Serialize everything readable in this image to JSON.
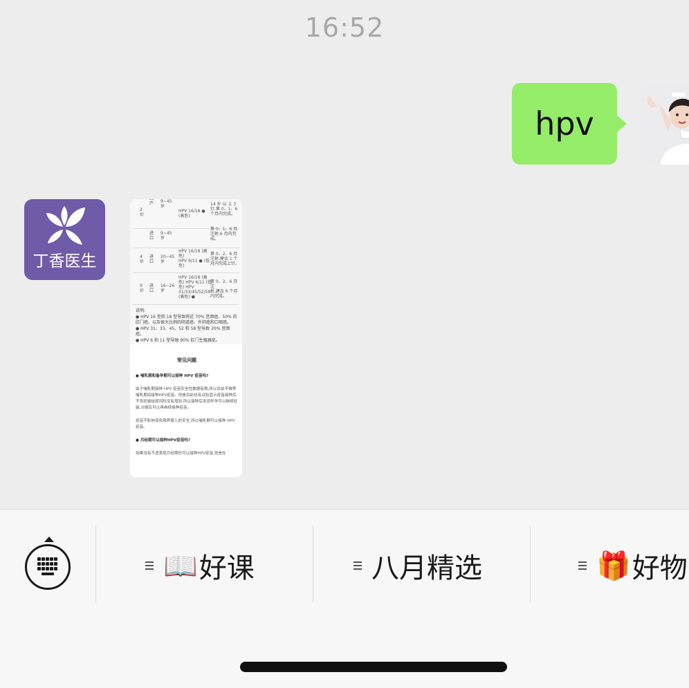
{
  "chat": {
    "timestamp": "16:52",
    "outgoing_message": "hpv",
    "bot_avatar_label": "丁香医生",
    "bot_avatar_color": "#6f5ba8",
    "outgoing_bubble_color": "#95ec69"
  },
  "doc_image": {
    "table_rows": [
      {
        "c1": "2\n价",
        "c2": "国\n产",
        "c3": "9~45\n岁",
        "c4": "HPV 16/18 ●\n(高危)",
        "c5": "14 岁 以 上 3\n针,第 0、1、6\n个月内完成。"
      },
      {
        "c1": "",
        "c2": "进\n口",
        "c3": "9~45\n岁",
        "c4": "",
        "c5": "第 0、1、6 月\n注射,6 月内完\n成。"
      },
      {
        "c1": "4\n价",
        "c2": "进\n口",
        "c3": "20~45\n岁",
        "c4": "HPV 16/18 (高\n危)\nHPV 6/11 ● (低\n危)",
        "c5": "第 0、2、6 月\n注射,建议 1 个\n月内完成上针。"
      },
      {
        "c1": "9\n价",
        "c2": "进\n口",
        "c3": "16~26\n岁",
        "c4": "HPV 16/18 (高\n危) HPV 6/11 (低\n危) HPV\n31/33/45/52/58\n(高危) ●",
        "c5": "第 0、2、6 月注\n射,建议 6 个月\n内完成。"
      }
    ],
    "notes": [
      "说明:",
      "● HPV 16 型和 18 型导致将近 70% 宫颈癌、50% 的肛门癌、以及很大比例的阴道癌、外阴癌和口咽癌。",
      "● HPV 31、33、45、52 和 58 型导致 20% 宫颈癌。",
      "● HPV 6 和 11 型导致 90% 肛门生殖器疣。"
    ],
    "faq_title": "常见问题",
    "faq": [
      {
        "text": "● 哺乳期和备孕期可以接种 HPV 疫苗吗?",
        "q": true
      },
      {
        "text": "由于哺乳期接种 HPV 疫苗安全性数据有限,所以目前不推荐哺乳期间接种HPV疫苗。但是目前也有试验显示疫苗接种后不良妊娠结局风险没有增加,所以接种后发现怀孕可以继续妊娠,分娩后可以再继续接种疫苗。",
        "q": false
      },
      {
        "text": "疫苗不影响母乳喂养婴儿的安全,所以哺乳期可以接种 HPV 疫苗。",
        "q": false
      },
      {
        "text": "● 月经期可以接种HPV疫苗吗?",
        "q": true
      },
      {
        "text": "如果没有不适表现月经期也可以接种HPV疫苗,但是在",
        "q": false
      }
    ]
  },
  "menu": {
    "keyboard_toggle": "keyboard-icon",
    "items": [
      {
        "emoji": "📖",
        "label": "好课"
      },
      {
        "emoji": "",
        "label": "八月精选"
      },
      {
        "emoji": "🎁",
        "label": "好物"
      }
    ]
  }
}
